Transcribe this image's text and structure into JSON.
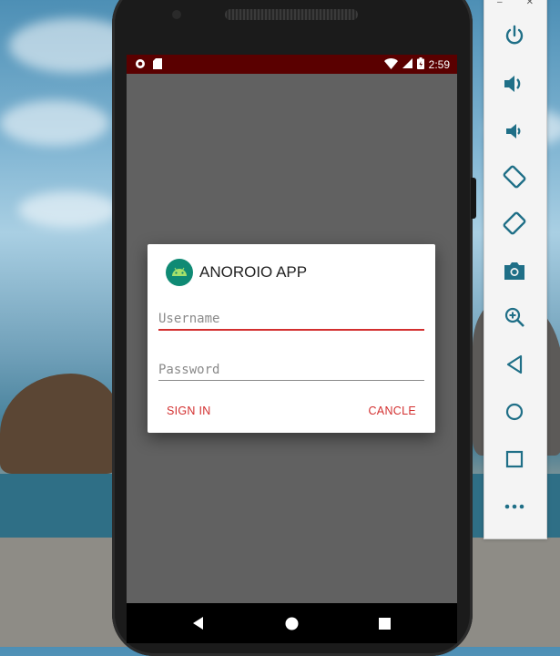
{
  "status_bar": {
    "time": "2:59"
  },
  "dialog": {
    "title": "ANOROIO APP",
    "username_placeholder": "Username",
    "password_placeholder": "Password",
    "sign_in_label": "SIGN IN",
    "cancel_label": "CANCLE"
  },
  "colors": {
    "accent": "#d32f2f",
    "status_bar": "#5a0000",
    "app_icon": "#0f8a74",
    "screen_bg": "#616161"
  },
  "emulator_toolbar": {
    "buttons": [
      "power-icon",
      "volume-up-icon",
      "volume-down-icon",
      "rotate-left-icon",
      "rotate-right-icon",
      "camera-icon",
      "zoom-icon",
      "back-icon",
      "home-icon",
      "overview-icon",
      "more-icon"
    ]
  },
  "nav_bar": {
    "buttons": [
      "back-icon",
      "home-icon",
      "recents-icon"
    ]
  }
}
